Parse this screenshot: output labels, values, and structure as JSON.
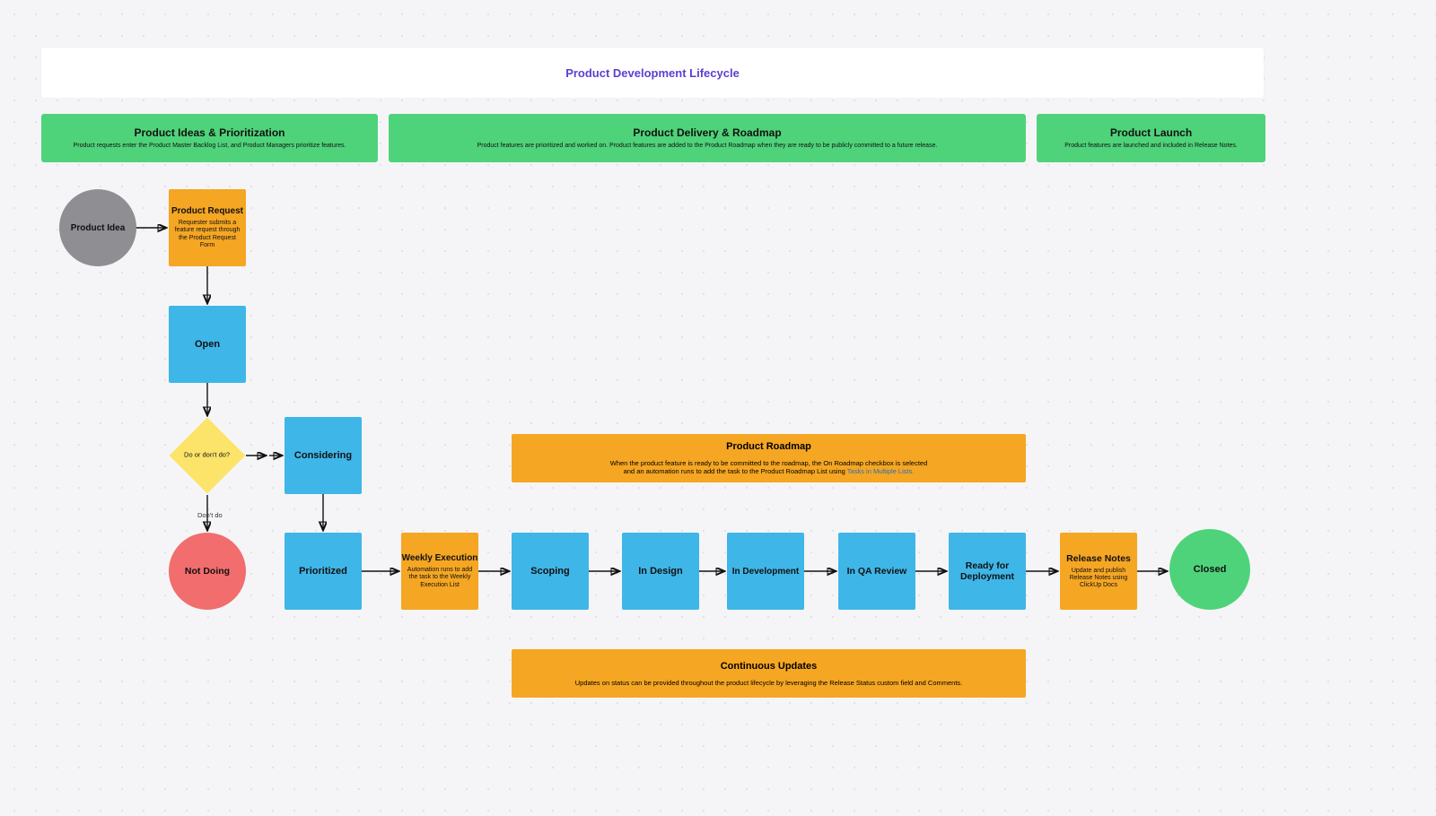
{
  "title": "Product Development Lifecycle",
  "phases": {
    "ideas": {
      "heading": "Product Ideas & Prioritization",
      "sub": "Product requests enter the Product Master Backlog List, and Product Managers prioritize features."
    },
    "delivery": {
      "heading": "Product Delivery & Roadmap",
      "sub": "Product features are prioritized and worked on. Product features are added to the Product Roadmap when they are ready to be publicly committed to a future release."
    },
    "launch": {
      "heading": "Product Launch",
      "sub": "Product features are launched and included in Release Notes."
    }
  },
  "nodes": {
    "productIdea": {
      "label": "Product Idea"
    },
    "productRequest": {
      "label": "Product Request",
      "sub": "Requester submits a feature request through the Product Request Form"
    },
    "open": {
      "label": "Open"
    },
    "decision": {
      "label": "Do or don't do?"
    },
    "considering": {
      "label": "Considering"
    },
    "notDoing": {
      "label": "Not Doing"
    },
    "prioritized": {
      "label": "Prioritized"
    },
    "weeklyExecution": {
      "label": "Weekly Execution",
      "sub": "Automation runs to add the task to the Weekly Execution List"
    },
    "scoping": {
      "label": "Scoping"
    },
    "inDesign": {
      "label": "In Design"
    },
    "inDevelopment": {
      "label": "In Development"
    },
    "inQA": {
      "label": "In QA Review"
    },
    "readyDeploy": {
      "label": "Ready for Deployment"
    },
    "releaseNotes": {
      "label": "Release Notes",
      "sub": "Update and publish Release Notes using ClickUp Docs"
    },
    "closed": {
      "label": "Closed"
    }
  },
  "banners": {
    "roadmap": {
      "heading": "Product Roadmap",
      "sub1": "When the product feature is ready to be committed to the roadmap, the On Roadmap checkbox is selected",
      "sub2": "and an automation runs to add the task to the Product Roadmap List using ",
      "link": "Tasks in Multiple Lists."
    },
    "continuous": {
      "heading": "Continuous Updates",
      "sub": "Updates on status can be provided throughout the product lifecycle by leveraging the Release Status custom field and Comments."
    }
  },
  "edgeLabels": {
    "dontDo": "Don't do"
  }
}
